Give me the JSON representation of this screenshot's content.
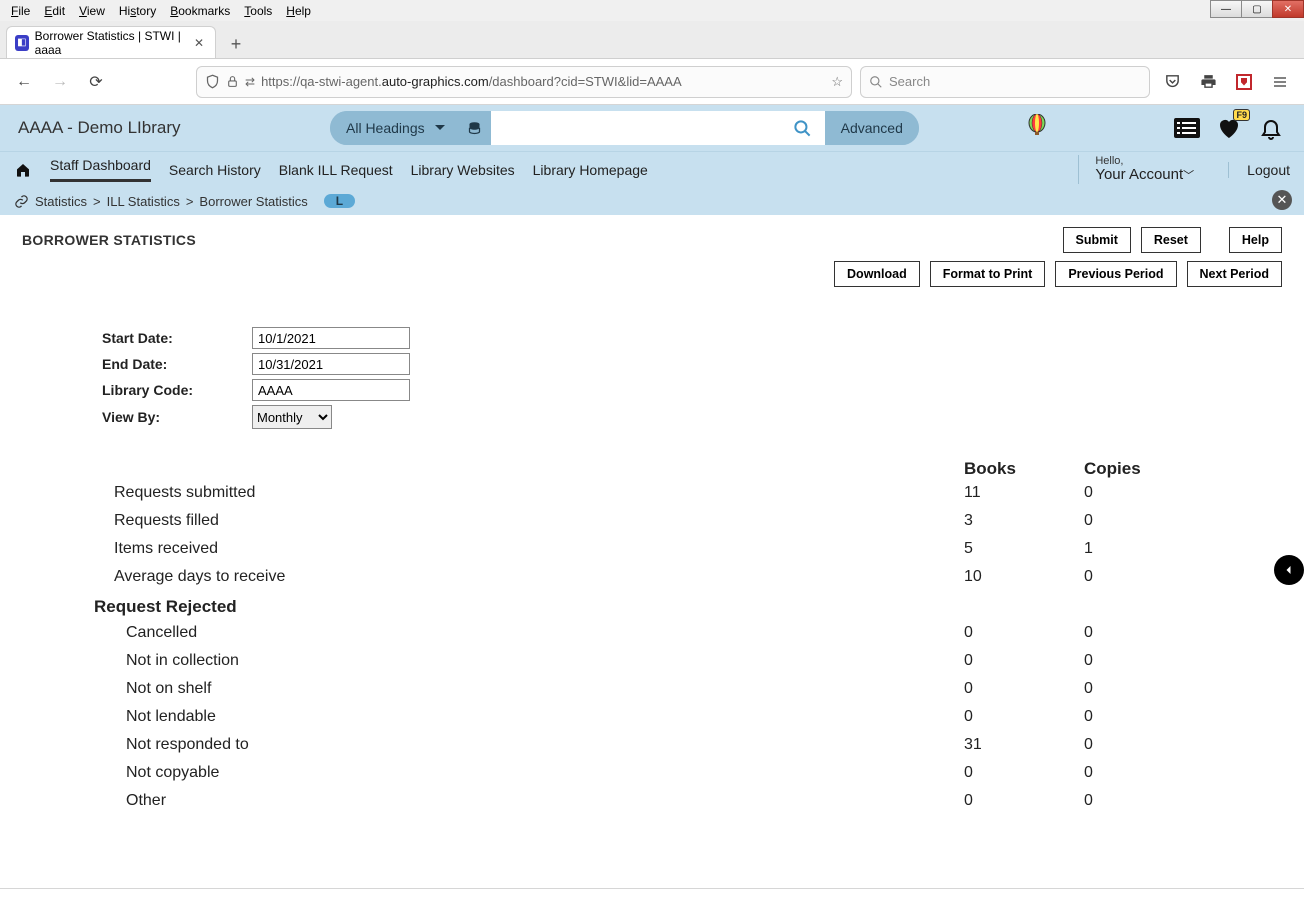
{
  "browser": {
    "menus": [
      "File",
      "Edit",
      "View",
      "History",
      "Bookmarks",
      "Tools",
      "Help"
    ],
    "tab_title": "Borrower Statistics | STWI | aaaa",
    "url_prefix": "https://qa-stwi-agent.",
    "url_host": "auto-graphics.com",
    "url_path": "/dashboard?cid=STWI&lid=AAAA",
    "search_placeholder": "Search"
  },
  "header": {
    "site_title": "AAAA - Demo LIbrary",
    "dropdown": "All Headings",
    "advanced": "Advanced",
    "fav_badge": "F9"
  },
  "nav": {
    "items": [
      "Staff Dashboard",
      "Search History",
      "Blank ILL Request",
      "Library Websites",
      "Library Homepage"
    ],
    "hello": "Hello,",
    "account": "Your Account",
    "logout": "Logout"
  },
  "crumb": {
    "a": "Statistics",
    "b": "ILL Statistics",
    "c": "Borrower Statistics",
    "pill": "L"
  },
  "page": {
    "title": "BORROWER STATISTICS",
    "buttons1": {
      "submit": "Submit",
      "reset": "Reset",
      "help": "Help"
    },
    "buttons2": {
      "download": "Download",
      "format": "Format to Print",
      "prev": "Previous Period",
      "next": "Next Period"
    },
    "form": {
      "start_label": "Start Date:",
      "start_value": "10/1/2021",
      "end_label": "End Date:",
      "end_value": "10/31/2021",
      "lib_label": "Library Code:",
      "lib_value": "AAAA",
      "view_label": "View By:",
      "view_value": "Monthly"
    },
    "cols": {
      "books": "Books",
      "copies": "Copies"
    },
    "rows": [
      {
        "label": "Requests submitted",
        "books": "11",
        "copies": "0"
      },
      {
        "label": "Requests filled",
        "books": "3",
        "copies": "0"
      },
      {
        "label": "Items received",
        "books": "5",
        "copies": "1"
      },
      {
        "label": "Average days to receive",
        "books": "10",
        "copies": "0"
      }
    ],
    "section": "Request Rejected",
    "sub_rows": [
      {
        "label": "Cancelled",
        "books": "0",
        "copies": "0"
      },
      {
        "label": "Not in collection",
        "books": "0",
        "copies": "0"
      },
      {
        "label": "Not on shelf",
        "books": "0",
        "copies": "0"
      },
      {
        "label": "Not lendable",
        "books": "0",
        "copies": "0"
      },
      {
        "label": "Not responded to",
        "books": "31",
        "copies": "0"
      },
      {
        "label": "Not copyable",
        "books": "0",
        "copies": "0"
      },
      {
        "label": "Other",
        "books": "0",
        "copies": "0"
      }
    ]
  }
}
